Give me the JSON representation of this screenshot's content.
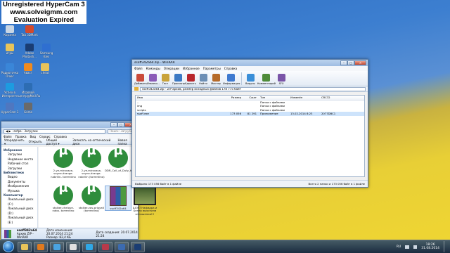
{
  "watermark": {
    "line1": "Unregistered HyperCam 3",
    "line2": "www.solveigmm.com",
    "line3": "Evaluation Expired"
  },
  "desktop_icons": [
    {
      "label": "Корзина",
      "color": "#c9d6e4"
    },
    {
      "label": "Tab 3DMark",
      "color": "#d44a2c"
    },
    {
      "label": "игры",
      "color": "#e8c45a"
    },
    {
      "label": "Adobe Photosh...",
      "color": "#1a3d73"
    },
    {
      "label": "Samsung Kies",
      "color": "#2f6fd0"
    },
    {
      "label": "Радиоточка Плюс",
      "color": "#3a86d8"
    },
    {
      "label": "Аваст",
      "color": "#f08a1e"
    },
    {
      "label": "cheat",
      "color": "#e8c45a"
    },
    {
      "label": "Успех в Интернете",
      "color": "#1d9be0"
    },
    {
      "label": "Игровой центр@Mail.Ru",
      "color": "#2d6db3"
    },
    {
      "label": "HyperCam 3",
      "color": "#4f77c0"
    },
    {
      "label": "Game",
      "color": "#6a6a6a"
    }
  ],
  "explorer": {
    "title": "",
    "address": "◀ ▶ · anfpa · Загрузки",
    "search_placeholder": "Поиск: Загрузки",
    "menu": [
      "Файл",
      "Правка",
      "Вид",
      "Сервис",
      "Справка"
    ],
    "toolbar": [
      "Упорядочить ▾",
      "Открыть",
      "Общий доступ ▾",
      "Записать на оптический диск",
      "Новая папка"
    ],
    "nav": [
      {
        "label": "Избранное",
        "group": true
      },
      {
        "label": "Загрузки",
        "group": false
      },
      {
        "label": "Недавние места",
        "group": false
      },
      {
        "label": "Рабочий стол",
        "group": false
      },
      {
        "label": "Загрузки",
        "group": false
      },
      {
        "label": "Библиотеки",
        "group": true
      },
      {
        "label": "Видео",
        "group": false
      },
      {
        "label": "Документы",
        "group": false
      },
      {
        "label": "Изображения",
        "group": false
      },
      {
        "label": "Музыка",
        "group": false
      },
      {
        "label": "Компьютер",
        "group": true
      },
      {
        "label": "Локальный диск (C:)",
        "group": false
      },
      {
        "label": "Локальный диск (D:)",
        "group": false
      },
      {
        "label": "Локальный диск (E:)",
        "group": false
      }
    ],
    "files": [
      {
        "name": "2-ye-mirovaya-voyne-drange-nabrilin- torrentino",
        "kind": "torrent"
      },
      {
        "name": "2-ye-mirovaya-voyne-drange-nabrilin (torrentino)",
        "kind": "torrent"
      },
      {
        "name": "DDR_Call_of_Duty_torrentino",
        "kind": "torrent"
      },
      {
        "name": "stalker-chelove-nabo- torrentino",
        "kind": "torrent"
      },
      {
        "name": "stalker-zov-pripyati (torrentino)",
        "kind": "torrent"
      },
      {
        "name": "ssoff342a64",
        "kind": "rar"
      },
      {
        "name": "ШОК! Нафидра и Белла выяснили отношения!!!",
        "kind": "video"
      }
    ],
    "status": {
      "name": "ssoff342a64",
      "type": "Архив ZIP - WinRAR",
      "modified": "Дата изменения: 20.07.2014 21:24",
      "size": "Размер: 82,4 КБ",
      "created": "Дата создания: 20.07.2014 21:24"
    }
  },
  "winrar": {
    "title": "ssoff342a64.zip - WinRAR",
    "menu": [
      "Файл",
      "Команды",
      "Операции",
      "Избранное",
      "Параметры",
      "Справка"
    ],
    "tools": [
      {
        "label": "Добавить",
        "color": "#c94a3a"
      },
      {
        "label": "Извлечь...",
        "color": "#8a5bb8"
      },
      {
        "label": "Тест",
        "color": "#c9a33a"
      },
      {
        "label": "Просмотр",
        "color": "#3b79c4"
      },
      {
        "label": "Удалить",
        "color": "#b8262c"
      },
      {
        "label": "Найти",
        "color": "#6d8fb5"
      },
      {
        "label": "Мастер",
        "color": "#b66b2a"
      },
      {
        "label": "Информация",
        "color": "#3e7ad0"
      },
      {
        "label": "Вирусы",
        "color": "#3b8fd8"
      },
      {
        "label": "Комментарий",
        "color": "#4f8c3a"
      },
      {
        "label": "SFX",
        "color": "#7a55a8"
      }
    ],
    "path": "ssoff342a64.zip - ZIP архив, размер исходных файлов 178 775 байт",
    "columns": [
      "Имя",
      "Размер",
      "Сжат",
      "Тип",
      "Изменён",
      "CRC32"
    ],
    "rows": [
      {
        "name": "..",
        "size": "",
        "packed": "",
        "type": "Папка с файлами",
        "modified": "",
        "crc": "",
        "selected": false
      },
      {
        "name": "img",
        "size": "",
        "packed": "",
        "type": "Папка с файлами",
        "modified": "",
        "crc": "",
        "selected": false
      },
      {
        "name": "scripts",
        "size": "",
        "packed": "",
        "type": "Папка с файлами",
        "modified": "",
        "crc": "",
        "selected": false
      },
      {
        "name": "ssoff.exe",
        "size": "173 056",
        "packed": "81 291",
        "type": "Приложение",
        "modified": "13.02.2014 8:23",
        "crc": "2077DBC1",
        "selected": true
      }
    ],
    "status_left": "Выбрано 173 056 байт в 1 файле",
    "status_right": "Всего 2 папки и 173 056 байт в 1 файле"
  },
  "taskbar": {
    "apps": [
      {
        "name": "explorer",
        "color": "#e8c45a"
      },
      {
        "name": "media",
        "color": "#e07a1e"
      },
      {
        "name": "browser",
        "color": "#4aa3e0"
      },
      {
        "name": "mail",
        "color": "#e0e0e0"
      },
      {
        "name": "skype",
        "color": "#2fa8e6"
      },
      {
        "name": "winrar",
        "color": "#b83a4a"
      },
      {
        "name": "hypercam",
        "color": "#3c6bb0"
      },
      {
        "name": "photoshop",
        "color": "#1a3d73"
      }
    ],
    "lang": "RU",
    "time": "18:26",
    "date": "31.08.2014"
  },
  "colors": {
    "accent": "#2b5797",
    "flag_blue": "#3d7fd0",
    "flag_yellow": "#f0d632"
  }
}
